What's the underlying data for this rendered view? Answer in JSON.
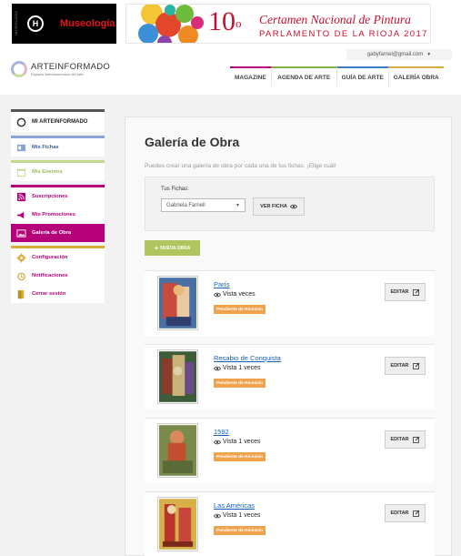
{
  "ads": {
    "left_brand": "Museología",
    "left_vertical_text": "MUSEOLOGÍA",
    "right_number": "10",
    "right_ordinal": "o",
    "right_title": "Certamen Nacional de Pintura",
    "right_subtitle": "PARLAMENTO DE LA RIOJA 2017"
  },
  "header": {
    "user_email": "gabyfarnel@gmail.com",
    "brand_name": "ARTEINFORMADO",
    "brand_tagline": "Espacio Iberoamericano del arte",
    "nav": [
      "MAGAZINE",
      "AGENDA DE ARTE",
      "GUÍA DE ARTE",
      "GALERÍA OBRA"
    ]
  },
  "sidebar": {
    "title": "MI ARTEINFORMADO",
    "fichas": "Mis Fichas",
    "eventos": "Mis Eventos",
    "suscripciones": "Suscripciones",
    "promociones": "Mis Promociones",
    "galeria": "Galería de Obra",
    "configuracion": "Configuración",
    "notificaciones": "Notificaciones",
    "cerrar": "Cerrar sesión"
  },
  "main": {
    "title": "Galería de Obra",
    "subtitle": "Puedes crear una galería de obra por cada una de tus fichas. ¡Elige cuál!",
    "fichas_label": "Tus Fichas:",
    "fichas_selected": "Gabriela Farnell",
    "ver_ficha": "VER FICHA",
    "nueva_obra": "NUEVA OBRA",
    "nueva_plus": "+"
  },
  "works": [
    {
      "title": "París",
      "views": "Vista veces",
      "status": "Pendiente de Revisión",
      "edit": "EDITAR"
    },
    {
      "title": "Resabio de Conquista",
      "views": "Vista 1 veces",
      "status": "Pendiente de Revisión",
      "edit": "EDITAR"
    },
    {
      "title": "1592",
      "views": "Vista 1 veces",
      "status": "Pendiente de Revisión",
      "edit": "EDITAR"
    },
    {
      "title": "Las Américas",
      "views": "Vista 1 veces",
      "status": "Pendiente de Revisión",
      "edit": "EDITAR"
    }
  ],
  "colors": {
    "magenta": "#b5007a",
    "green": "#afc55f",
    "orange_badge": "#f0a24d",
    "link_blue": "#1560bd",
    "ad_red": "#c8102e"
  }
}
